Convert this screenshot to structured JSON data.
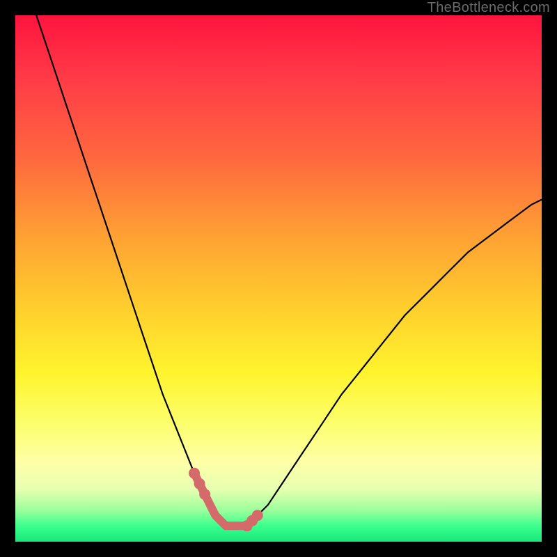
{
  "watermark": "TheBottleneck.com",
  "colors": {
    "frame": "#000000",
    "gradient_top": "#ff143e",
    "gradient_bottom": "#17e878",
    "curve": "#000000",
    "marker": "#d46a6a"
  },
  "chart_data": {
    "type": "line",
    "title": "",
    "xlabel": "",
    "ylabel": "",
    "xlim": [
      0,
      100
    ],
    "ylim": [
      0,
      100
    ],
    "series": [
      {
        "name": "bottleneck-curve",
        "x": [
          4,
          6,
          8,
          10,
          12,
          14,
          16,
          18,
          20,
          22,
          24,
          26,
          28,
          30,
          32,
          34,
          35,
          36,
          37,
          38,
          39,
          40,
          41,
          42,
          43,
          44,
          45,
          46,
          48,
          50,
          54,
          58,
          62,
          66,
          70,
          74,
          78,
          82,
          86,
          90,
          94,
          98,
          100
        ],
        "y": [
          100,
          94,
          88,
          82,
          76,
          70,
          64,
          58,
          52,
          46,
          40,
          34,
          28,
          23,
          18,
          13,
          11,
          9,
          7,
          5,
          4,
          3,
          3,
          3,
          3,
          3,
          4,
          5,
          7,
          10,
          16,
          22,
          28,
          33,
          38,
          43,
          47,
          51,
          55,
          58,
          61,
          64,
          65
        ]
      }
    ],
    "markers": {
      "name": "highlighted-points",
      "color": "#d46a6a",
      "x": [
        34,
        35,
        36,
        37,
        38,
        39,
        40,
        41,
        42,
        43,
        44,
        45,
        46
      ],
      "y": [
        13,
        11,
        9,
        7,
        5,
        4,
        3,
        3,
        3,
        3,
        3,
        4,
        5
      ]
    }
  }
}
